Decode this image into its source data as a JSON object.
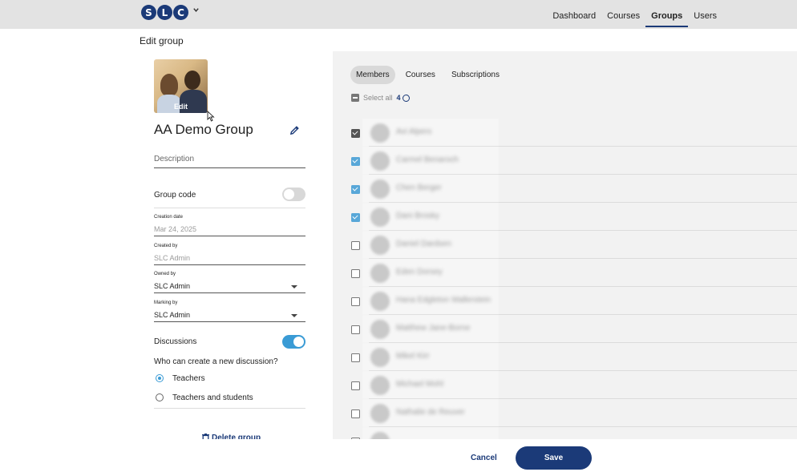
{
  "header": {
    "logo_letters": [
      "S",
      "L",
      "C"
    ],
    "nav": [
      {
        "label": "Dashboard",
        "active": false
      },
      {
        "label": "Courses",
        "active": false
      },
      {
        "label": "Groups",
        "active": true
      },
      {
        "label": "Users",
        "active": false
      }
    ],
    "accent_color": "#1b3a78"
  },
  "page": {
    "title": "Edit group"
  },
  "group": {
    "photo_edit_label": "Edit",
    "name": "AA Demo Group",
    "description_placeholder": "Description",
    "group_code_label": "Group code",
    "group_code_enabled": false,
    "creation_date_label": "Creation date",
    "creation_date": "Mar 24, 2025",
    "created_by_label": "Created by",
    "created_by": "SLC Admin",
    "owned_by_label": "Owned by",
    "owned_by": "SLC Admin",
    "marking_by_label": "Marking by",
    "marking_by": "SLC Admin",
    "discussions_label": "Discussions",
    "discussions_enabled": true,
    "discussion_question": "Who can create a new discussion?",
    "discussion_options": [
      {
        "label": "Teachers",
        "selected": true
      },
      {
        "label": "Teachers and students",
        "selected": false
      }
    ],
    "delete_label": "Delete group"
  },
  "members_panel": {
    "tabs": [
      {
        "label": "Members",
        "active": true
      },
      {
        "label": "Courses",
        "active": false
      },
      {
        "label": "Subscriptions",
        "active": false
      }
    ],
    "select_all_label": "Select all",
    "selected_count": "4",
    "members": [
      {
        "name": "Avi Alpers",
        "state": "checked-dark"
      },
      {
        "name": "Carmel Benaroch",
        "state": "checked-blue"
      },
      {
        "name": "Chen Berger",
        "state": "checked-blue"
      },
      {
        "name": "Dani Brosky",
        "state": "checked-blue"
      },
      {
        "name": "Daniel Dardsen",
        "state": "empty"
      },
      {
        "name": "Eden Dorsey",
        "state": "empty"
      },
      {
        "name": "Hana Edgleton Wallerstein",
        "state": "empty"
      },
      {
        "name": "Matthew Jane-Borne",
        "state": "empty"
      },
      {
        "name": "Mikel Kirr",
        "state": "empty"
      },
      {
        "name": "Michael Mohl",
        "state": "empty"
      },
      {
        "name": "Nathalie de Reuver",
        "state": "empty"
      },
      {
        "name": "",
        "state": "empty"
      }
    ]
  },
  "actions": {
    "cancel_label": "Cancel",
    "save_label": "Save"
  }
}
